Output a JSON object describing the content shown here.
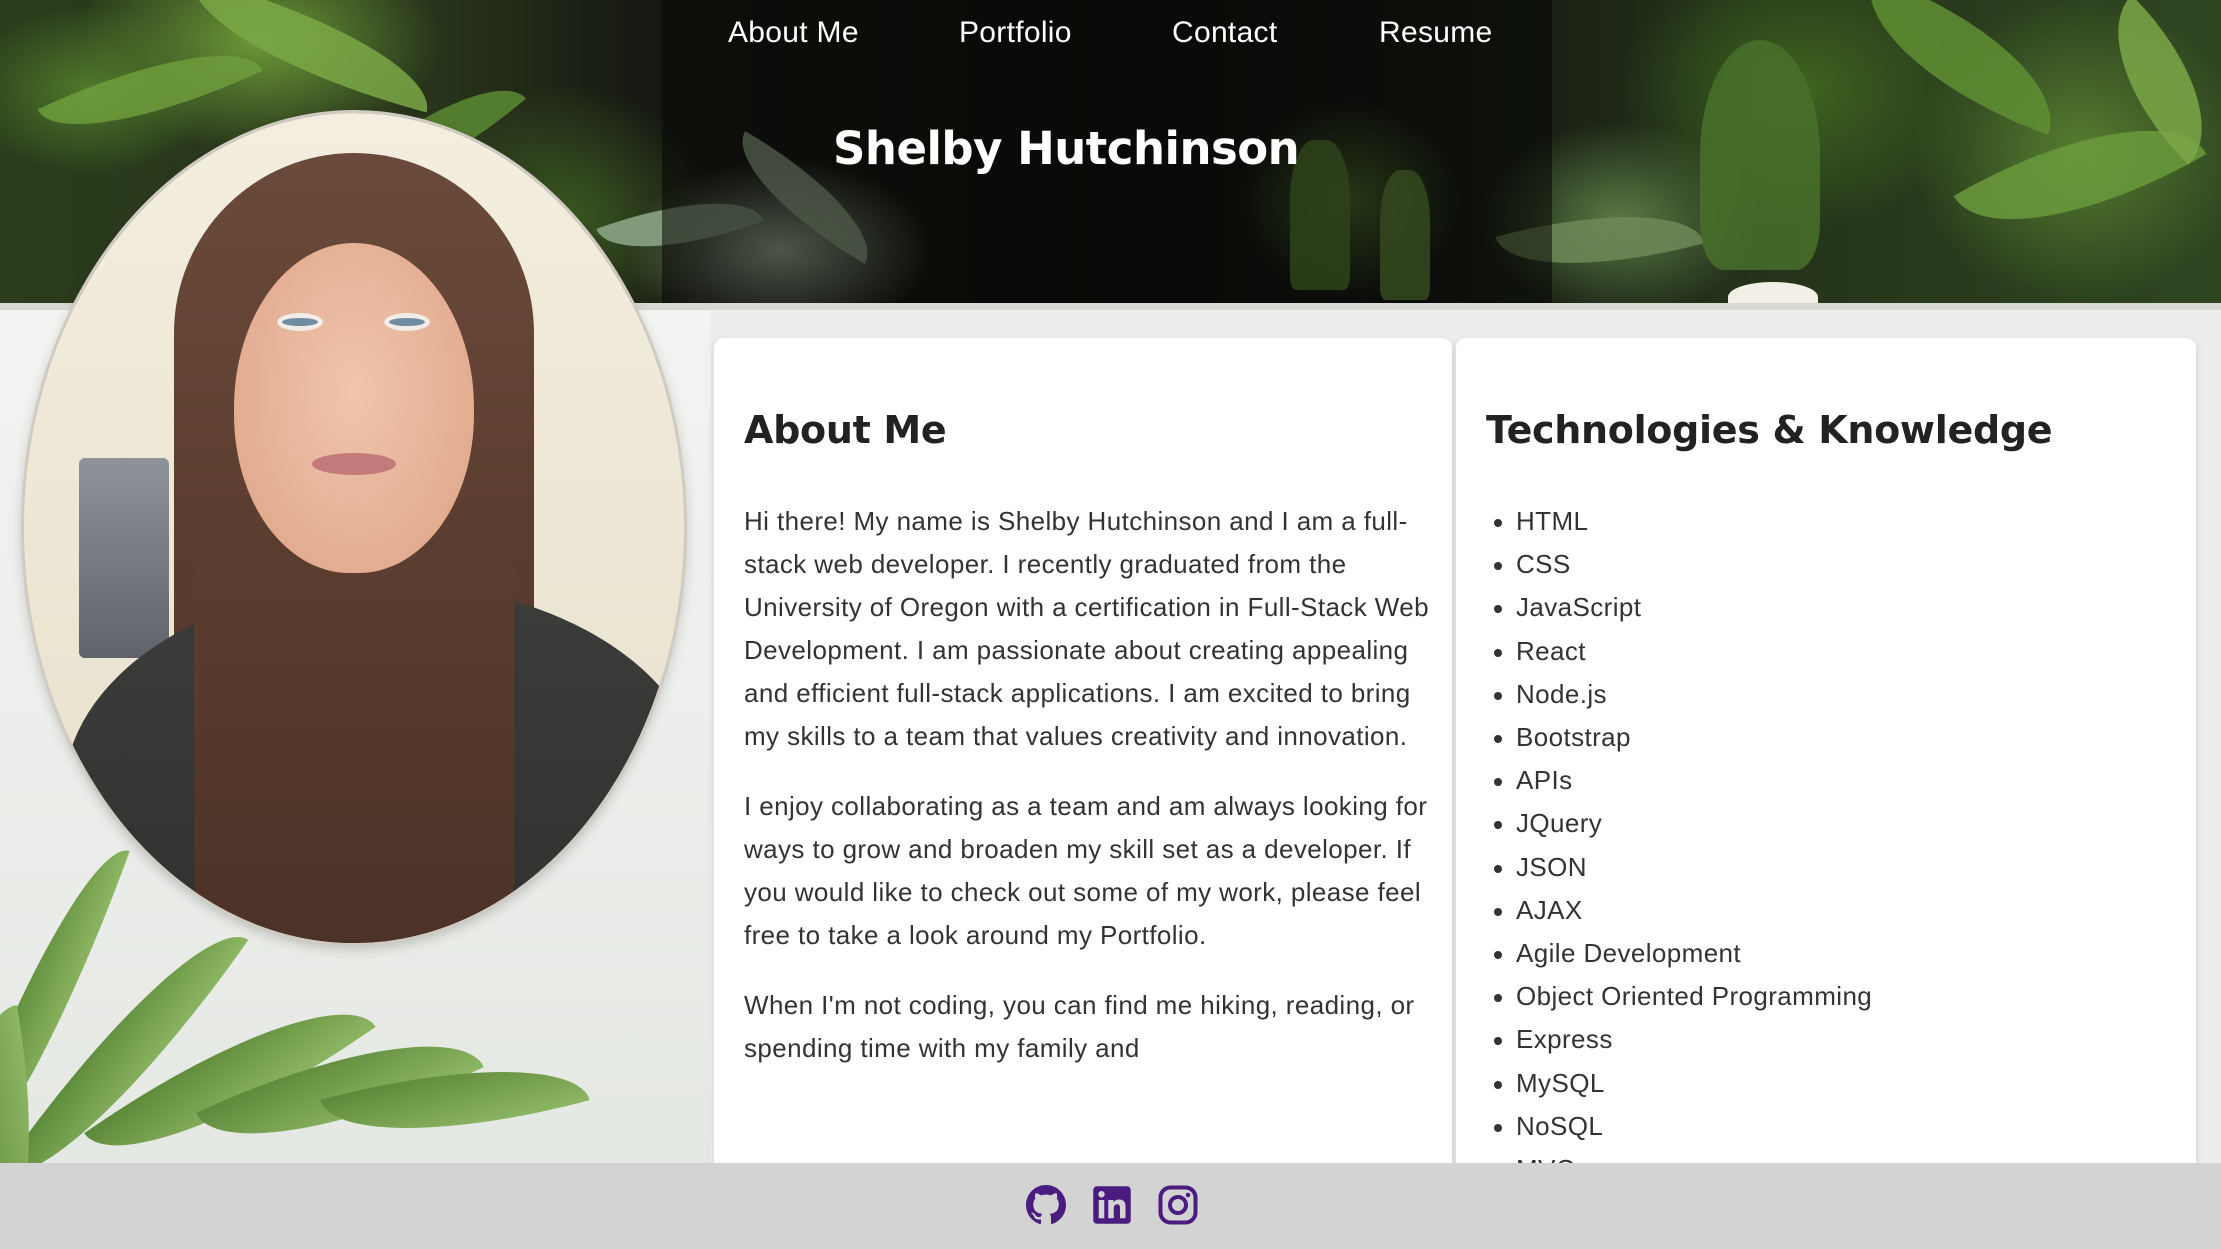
{
  "nav": {
    "items": [
      {
        "label": "About Me"
      },
      {
        "label": "Portfolio"
      },
      {
        "label": "Contact"
      },
      {
        "label": "Resume"
      }
    ]
  },
  "header": {
    "title": "Shelby Hutchinson"
  },
  "about": {
    "heading": "About Me",
    "paragraphs": [
      "Hi there! My name is Shelby Hutchinson and I am a full-stack web developer. I recently graduated from the University of Oregon with a certification in Full-Stack Web Development. I am passionate about creating appealing and efficient full-stack applications. I am excited to bring my skills to a team that values creativity and innovation.",
      "I enjoy collaborating as a team and am always looking for ways to grow and broaden my skill set as a developer. If you would like to check out some of my work, please feel free to take a look around my Portfolio.",
      "When I'm not coding, you can find me hiking, reading, or spending time with my family and"
    ]
  },
  "technologies": {
    "heading": "Technologies & Knowledge",
    "items": [
      "HTML",
      "CSS",
      "JavaScript",
      "React",
      "Node.js",
      "Bootstrap",
      "APIs",
      "JQuery",
      "JSON",
      "AJAX",
      "Agile Development",
      "Object Oriented Programming",
      "Express",
      "MySQL",
      "NoSQL",
      "MVC"
    ]
  },
  "footer": {
    "icons": [
      "github-icon",
      "linkedin-icon",
      "instagram-icon"
    ],
    "icon_color": "#4b1c7f"
  },
  "colors": {
    "footer_background": "#d3d3d3",
    "card_background": "#ffffff",
    "page_background": "#eeedeb",
    "nav_text": "#ffffff"
  }
}
